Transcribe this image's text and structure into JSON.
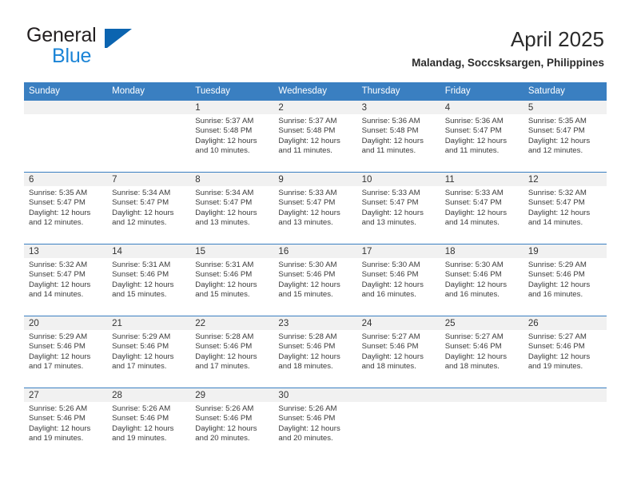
{
  "brand": {
    "name_top": "General",
    "name_bottom": "Blue",
    "flag_icon": "general-blue-flag-icon",
    "color_dark": "#231f20",
    "color_blue": "#1b84d6"
  },
  "header": {
    "title": "April 2025",
    "subtitle": "Malandag, Soccsksargen, Philippines"
  },
  "theme": {
    "header_blue": "#3a7fc1",
    "daynum_band": "#f1f1f1",
    "text": "#3a3a3a"
  },
  "weekday_headers": [
    "Sunday",
    "Monday",
    "Tuesday",
    "Wednesday",
    "Thursday",
    "Friday",
    "Saturday"
  ],
  "labels": {
    "sunrise_prefix": "Sunrise:",
    "sunset_prefix": "Sunset:",
    "daylight_prefix": "Daylight:"
  },
  "weeks": [
    [
      {
        "day": "",
        "empty": true
      },
      {
        "day": "",
        "empty": true
      },
      {
        "day": "1",
        "sunrise": "Sunrise: 5:37 AM",
        "sunset": "Sunset: 5:48 PM",
        "daylight1": "Daylight: 12 hours",
        "daylight2": "and 10 minutes."
      },
      {
        "day": "2",
        "sunrise": "Sunrise: 5:37 AM",
        "sunset": "Sunset: 5:48 PM",
        "daylight1": "Daylight: 12 hours",
        "daylight2": "and 11 minutes."
      },
      {
        "day": "3",
        "sunrise": "Sunrise: 5:36 AM",
        "sunset": "Sunset: 5:48 PM",
        "daylight1": "Daylight: 12 hours",
        "daylight2": "and 11 minutes."
      },
      {
        "day": "4",
        "sunrise": "Sunrise: 5:36 AM",
        "sunset": "Sunset: 5:47 PM",
        "daylight1": "Daylight: 12 hours",
        "daylight2": "and 11 minutes."
      },
      {
        "day": "5",
        "sunrise": "Sunrise: 5:35 AM",
        "sunset": "Sunset: 5:47 PM",
        "daylight1": "Daylight: 12 hours",
        "daylight2": "and 12 minutes."
      }
    ],
    [
      {
        "day": "6",
        "sunrise": "Sunrise: 5:35 AM",
        "sunset": "Sunset: 5:47 PM",
        "daylight1": "Daylight: 12 hours",
        "daylight2": "and 12 minutes."
      },
      {
        "day": "7",
        "sunrise": "Sunrise: 5:34 AM",
        "sunset": "Sunset: 5:47 PM",
        "daylight1": "Daylight: 12 hours",
        "daylight2": "and 12 minutes."
      },
      {
        "day": "8",
        "sunrise": "Sunrise: 5:34 AM",
        "sunset": "Sunset: 5:47 PM",
        "daylight1": "Daylight: 12 hours",
        "daylight2": "and 13 minutes."
      },
      {
        "day": "9",
        "sunrise": "Sunrise: 5:33 AM",
        "sunset": "Sunset: 5:47 PM",
        "daylight1": "Daylight: 12 hours",
        "daylight2": "and 13 minutes."
      },
      {
        "day": "10",
        "sunrise": "Sunrise: 5:33 AM",
        "sunset": "Sunset: 5:47 PM",
        "daylight1": "Daylight: 12 hours",
        "daylight2": "and 13 minutes."
      },
      {
        "day": "11",
        "sunrise": "Sunrise: 5:33 AM",
        "sunset": "Sunset: 5:47 PM",
        "daylight1": "Daylight: 12 hours",
        "daylight2": "and 14 minutes."
      },
      {
        "day": "12",
        "sunrise": "Sunrise: 5:32 AM",
        "sunset": "Sunset: 5:47 PM",
        "daylight1": "Daylight: 12 hours",
        "daylight2": "and 14 minutes."
      }
    ],
    [
      {
        "day": "13",
        "sunrise": "Sunrise: 5:32 AM",
        "sunset": "Sunset: 5:47 PM",
        "daylight1": "Daylight: 12 hours",
        "daylight2": "and 14 minutes."
      },
      {
        "day": "14",
        "sunrise": "Sunrise: 5:31 AM",
        "sunset": "Sunset: 5:46 PM",
        "daylight1": "Daylight: 12 hours",
        "daylight2": "and 15 minutes."
      },
      {
        "day": "15",
        "sunrise": "Sunrise: 5:31 AM",
        "sunset": "Sunset: 5:46 PM",
        "daylight1": "Daylight: 12 hours",
        "daylight2": "and 15 minutes."
      },
      {
        "day": "16",
        "sunrise": "Sunrise: 5:30 AM",
        "sunset": "Sunset: 5:46 PM",
        "daylight1": "Daylight: 12 hours",
        "daylight2": "and 15 minutes."
      },
      {
        "day": "17",
        "sunrise": "Sunrise: 5:30 AM",
        "sunset": "Sunset: 5:46 PM",
        "daylight1": "Daylight: 12 hours",
        "daylight2": "and 16 minutes."
      },
      {
        "day": "18",
        "sunrise": "Sunrise: 5:30 AM",
        "sunset": "Sunset: 5:46 PM",
        "daylight1": "Daylight: 12 hours",
        "daylight2": "and 16 minutes."
      },
      {
        "day": "19",
        "sunrise": "Sunrise: 5:29 AM",
        "sunset": "Sunset: 5:46 PM",
        "daylight1": "Daylight: 12 hours",
        "daylight2": "and 16 minutes."
      }
    ],
    [
      {
        "day": "20",
        "sunrise": "Sunrise: 5:29 AM",
        "sunset": "Sunset: 5:46 PM",
        "daylight1": "Daylight: 12 hours",
        "daylight2": "and 17 minutes."
      },
      {
        "day": "21",
        "sunrise": "Sunrise: 5:29 AM",
        "sunset": "Sunset: 5:46 PM",
        "daylight1": "Daylight: 12 hours",
        "daylight2": "and 17 minutes."
      },
      {
        "day": "22",
        "sunrise": "Sunrise: 5:28 AM",
        "sunset": "Sunset: 5:46 PM",
        "daylight1": "Daylight: 12 hours",
        "daylight2": "and 17 minutes."
      },
      {
        "day": "23",
        "sunrise": "Sunrise: 5:28 AM",
        "sunset": "Sunset: 5:46 PM",
        "daylight1": "Daylight: 12 hours",
        "daylight2": "and 18 minutes."
      },
      {
        "day": "24",
        "sunrise": "Sunrise: 5:27 AM",
        "sunset": "Sunset: 5:46 PM",
        "daylight1": "Daylight: 12 hours",
        "daylight2": "and 18 minutes."
      },
      {
        "day": "25",
        "sunrise": "Sunrise: 5:27 AM",
        "sunset": "Sunset: 5:46 PM",
        "daylight1": "Daylight: 12 hours",
        "daylight2": "and 18 minutes."
      },
      {
        "day": "26",
        "sunrise": "Sunrise: 5:27 AM",
        "sunset": "Sunset: 5:46 PM",
        "daylight1": "Daylight: 12 hours",
        "daylight2": "and 19 minutes."
      }
    ],
    [
      {
        "day": "27",
        "sunrise": "Sunrise: 5:26 AM",
        "sunset": "Sunset: 5:46 PM",
        "daylight1": "Daylight: 12 hours",
        "daylight2": "and 19 minutes."
      },
      {
        "day": "28",
        "sunrise": "Sunrise: 5:26 AM",
        "sunset": "Sunset: 5:46 PM",
        "daylight1": "Daylight: 12 hours",
        "daylight2": "and 19 minutes."
      },
      {
        "day": "29",
        "sunrise": "Sunrise: 5:26 AM",
        "sunset": "Sunset: 5:46 PM",
        "daylight1": "Daylight: 12 hours",
        "daylight2": "and 20 minutes."
      },
      {
        "day": "30",
        "sunrise": "Sunrise: 5:26 AM",
        "sunset": "Sunset: 5:46 PM",
        "daylight1": "Daylight: 12 hours",
        "daylight2": "and 20 minutes."
      },
      {
        "day": "",
        "empty": true
      },
      {
        "day": "",
        "empty": true
      },
      {
        "day": "",
        "empty": true
      }
    ]
  ]
}
